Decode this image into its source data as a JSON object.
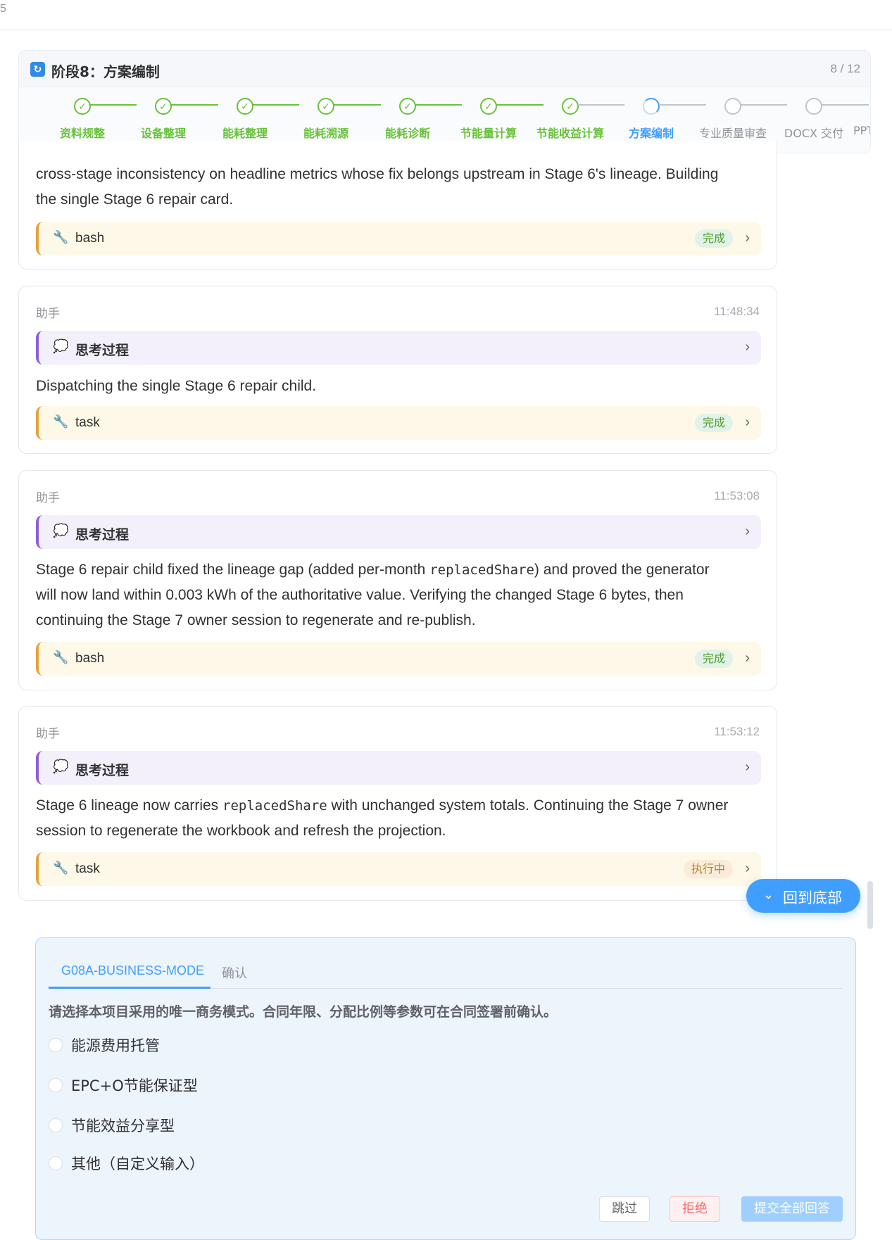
{
  "topbar": {
    "edge_char": "5"
  },
  "stage": {
    "icon": "↻",
    "title": "阶段8：方案编制",
    "count": "8 / 12",
    "steps": [
      {
        "label": "资料规整",
        "state": "done"
      },
      {
        "label": "设备整理",
        "state": "done"
      },
      {
        "label": "能耗整理",
        "state": "done"
      },
      {
        "label": "能耗溯源",
        "state": "done"
      },
      {
        "label": "能耗诊断",
        "state": "done"
      },
      {
        "label": "节能量计算",
        "state": "done"
      },
      {
        "label": "节能收益计算",
        "state": "done"
      },
      {
        "label": "方案编制",
        "state": "active"
      },
      {
        "label": "专业质量审查",
        "state": "pending"
      },
      {
        "label": "DOCX 交付",
        "state": "pending"
      },
      {
        "label": "PPTX",
        "state": "pending"
      }
    ]
  },
  "messages": [
    {
      "text_line1": "cross-stage inconsistency on headline metrics whose fix belongs upstream in Stage 6's lineage. Building",
      "text_line2": "the single Stage 6 repair card.",
      "tool": {
        "name": "bash",
        "status": "完成"
      }
    },
    {
      "role": "助手",
      "time": "11:48:34",
      "think_label": "思考过程",
      "text": "Dispatching the single Stage 6 repair child.",
      "tool": {
        "name": "task",
        "status": "完成"
      }
    },
    {
      "role": "助手",
      "time": "11:53:08",
      "think_label": "思考过程",
      "text_a": "Stage 6 repair child fixed the lineage gap (added per-month ",
      "code": "replacedShare",
      "text_b": ") and proved the generator",
      "text_line2": "will now land within 0.003 kWh of the authoritative value. Verifying the changed Stage 6 bytes, then",
      "text_line3": "continuing the Stage 7 owner session to regenerate and re-publish.",
      "tool": {
        "name": "bash",
        "status": "完成"
      }
    },
    {
      "role": "助手",
      "time": "11:53:12",
      "think_label": "思考过程",
      "text_a": "Stage 6 lineage now carries ",
      "code": "replacedShare",
      "text_b": " with unchanged system totals. Continuing the Stage 7 owner",
      "text_line2": "session to regenerate the workbook and refresh the projection.",
      "tool": {
        "name": "task",
        "status": "执行中"
      }
    }
  ],
  "back_to_bottom": "回到底部",
  "question": {
    "tabs": [
      "G08A-BUSINESS-MODE",
      "确认"
    ],
    "prompt": "请选择本项目采用的唯一商务模式。合同年限、分配比例等参数可在合同签署前确认。",
    "options": [
      "能源费用托管",
      "EPC+O节能保证型",
      "节能效益分享型",
      "其他（自定义输入）"
    ],
    "buttons": {
      "skip": "跳过",
      "reject": "拒绝",
      "submit": "提交全部回答"
    }
  },
  "colors": {
    "accent": "#409eff",
    "success": "#67c23a",
    "warning": "#e6a23c",
    "think": "#8c5ed9"
  }
}
